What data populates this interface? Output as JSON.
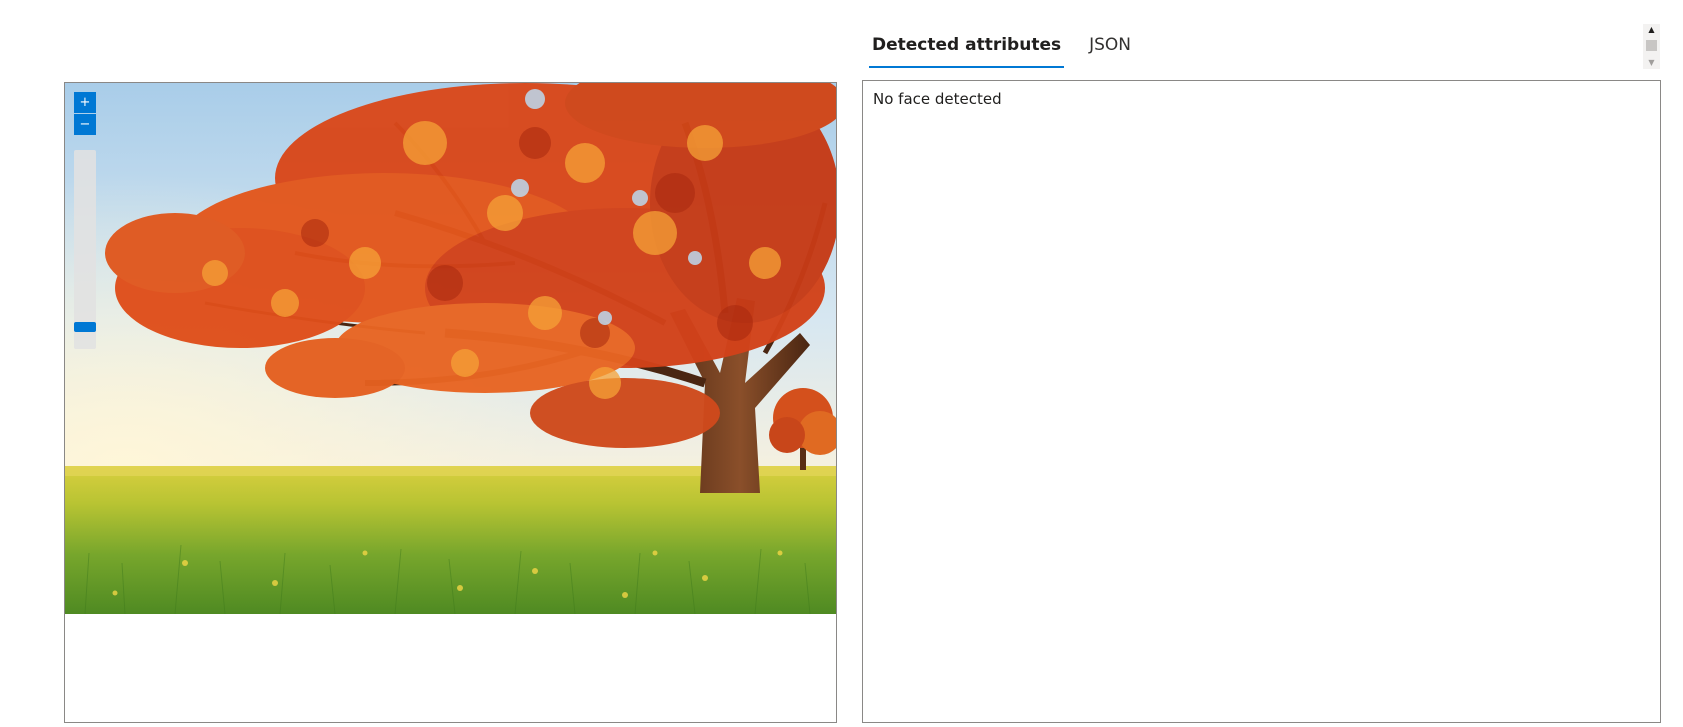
{
  "viewer": {
    "zoom_in_label": "+",
    "zoom_out_label": "−",
    "zoom_level": 0.04,
    "accent_color": "#0078d4",
    "photo_icon": "autumn-tree-photo"
  },
  "tabs": [
    {
      "label": "Detected attributes",
      "active": true
    },
    {
      "label": "JSON",
      "active": false
    }
  ],
  "results": {
    "message": "No face detected"
  },
  "scrollbar": {
    "up_arrow": "▲",
    "down_arrow": "▼"
  }
}
